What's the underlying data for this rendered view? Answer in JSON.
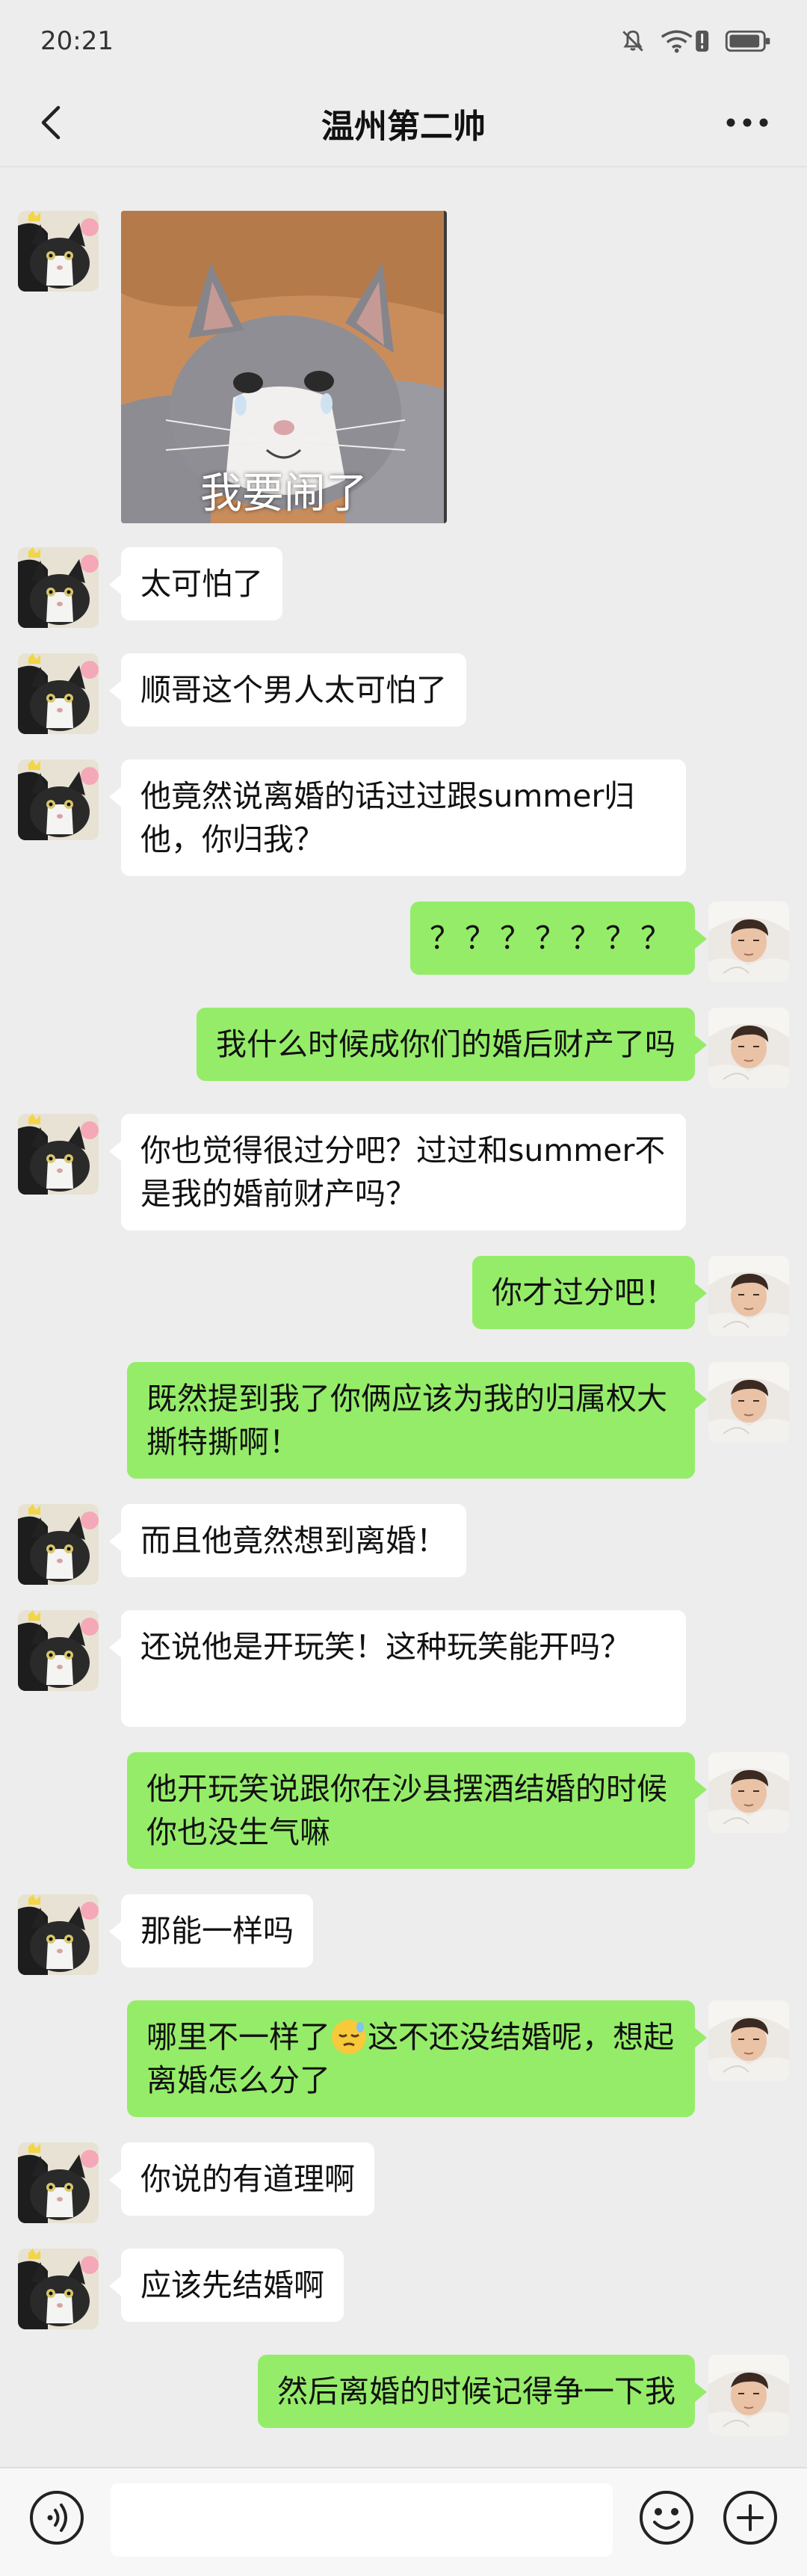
{
  "status_bar": {
    "time": "20:21",
    "icons": [
      "mute-icon",
      "wifi-alert-icon",
      "battery-icon"
    ]
  },
  "header": {
    "title": "温州第二帅",
    "back_icon": "chevron-left-icon",
    "more_icon": "more-dots-icon"
  },
  "colors": {
    "background": "#ededed",
    "sent_bubble": "#95ec69",
    "received_bubble": "#ffffff"
  },
  "messages": [
    {
      "side": "left",
      "type": "sticker",
      "caption": "我要闹了"
    },
    {
      "side": "left",
      "type": "text",
      "text": "太可怕了"
    },
    {
      "side": "left",
      "type": "text",
      "text": "顺哥这个男人太可怕了"
    },
    {
      "side": "left",
      "type": "text",
      "text": "他竟然说离婚的话过过跟summer归他，你归我？"
    },
    {
      "side": "right",
      "type": "text",
      "text": "？？？？？？？"
    },
    {
      "side": "right",
      "type": "text",
      "text": "我什么时候成你们的婚后财产了吗"
    },
    {
      "side": "left",
      "type": "text",
      "text": "你也觉得很过分吧？过过和summer不是我的婚前财产吗？"
    },
    {
      "side": "right",
      "type": "text",
      "text": "你才过分吧！"
    },
    {
      "side": "right",
      "type": "text",
      "text": "既然提到我了你俩应该为我的归属权大撕特撕啊！"
    },
    {
      "side": "left",
      "type": "text",
      "text": "而且他竟然想到离婚！"
    },
    {
      "side": "left",
      "type": "text",
      "text": "还说他是开玩笑！这种玩笑能开吗？"
    },
    {
      "side": "right",
      "type": "text",
      "text": "他开玩笑说跟你在沙县摆酒结婚的时候你也没生气嘛"
    },
    {
      "side": "left",
      "type": "text",
      "text": "那能一样吗"
    },
    {
      "side": "right",
      "type": "text",
      "text_before": "哪里不一样了",
      "emoji": "sleepy-face-emoji",
      "text_after": "这不还没结婚呢，想起离婚怎么分了"
    },
    {
      "side": "left",
      "type": "text",
      "text": "你说的有道理啊"
    },
    {
      "side": "left",
      "type": "text",
      "text": "应该先结婚啊"
    },
    {
      "side": "right",
      "type": "text",
      "text": "然后离婚的时候记得争一下我"
    }
  ],
  "input_bar": {
    "voice_icon": "voice-icon",
    "emoji_icon": "emoji-icon",
    "plus_icon": "plus-icon",
    "input_value": ""
  }
}
